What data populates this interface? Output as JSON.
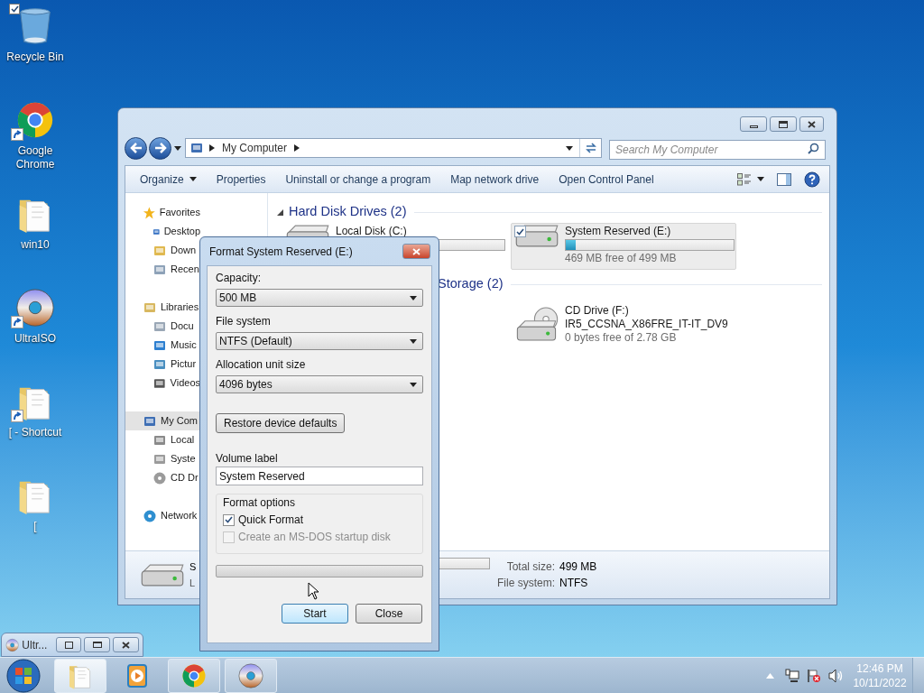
{
  "desktop_icons": [
    {
      "label": "Recycle Bin",
      "kind": "bin",
      "checked": true,
      "shortcut": false
    },
    {
      "label": "Google Chrome",
      "kind": "chrome",
      "checked": false,
      "shortcut": true
    },
    {
      "label": "win10",
      "kind": "folder",
      "checked": false,
      "shortcut": false
    },
    {
      "label": "UltraISO",
      "kind": "disc",
      "checked": false,
      "shortcut": true
    },
    {
      "label": "[ - Shortcut",
      "kind": "folder",
      "checked": false,
      "shortcut": true
    },
    {
      "label": "[",
      "kind": "folder",
      "checked": false,
      "shortcut": false
    }
  ],
  "explorer": {
    "address": "My Computer",
    "search_placeholder": "Search My Computer",
    "toolbar": [
      {
        "label": "Organize",
        "dropdown": true
      },
      {
        "label": "Properties",
        "dropdown": false
      },
      {
        "label": "Uninstall or change a program",
        "dropdown": false
      },
      {
        "label": "Map network drive",
        "dropdown": false
      },
      {
        "label": "Open Control Panel",
        "dropdown": false
      }
    ],
    "nav": [
      {
        "label": "Favorites",
        "kind": "star",
        "selected": false,
        "children": [
          {
            "label": "Desktop",
            "kind": "desktop",
            "selected": false
          },
          {
            "label": "Down",
            "kind": "download",
            "selected": false
          },
          {
            "label": "Recen",
            "kind": "recent",
            "selected": false
          }
        ]
      },
      {
        "label": "Libraries",
        "kind": "library",
        "selected": false,
        "children": [
          {
            "label": "Docu",
            "kind": "document",
            "selected": false
          },
          {
            "label": "Music",
            "kind": "music",
            "selected": false
          },
          {
            "label": "Pictur",
            "kind": "picture",
            "selected": false
          },
          {
            "label": "Videos",
            "kind": "video",
            "selected": false
          }
        ]
      },
      {
        "label": "My Com",
        "kind": "computer",
        "selected": true,
        "children": [
          {
            "label": "Local",
            "kind": "windows-drive",
            "selected": false
          },
          {
            "label": "Syste",
            "kind": "drive",
            "selected": false
          },
          {
            "label": "CD Dr",
            "kind": "cd",
            "selected": false
          }
        ]
      },
      {
        "label": "Network",
        "kind": "network",
        "selected": false
      }
    ],
    "groups": [
      {
        "title": "Hard Disk Drives (2)",
        "tiles": [
          {
            "name": "Local Disk (C:)",
            "kind": "hdd",
            "selected": false,
            "checked": false
          },
          {
            "name": "System Reserved (E:)",
            "kind": "hdd",
            "selected": true,
            "checked": true,
            "level": 0.06,
            "free": "469 MB free of 499 MB"
          }
        ]
      },
      {
        "title": "Storage (2)",
        "tiles": [
          {
            "name": "CD Drive (F:)",
            "kind": "cd",
            "selected": false,
            "checked": false,
            "subtitle": "IR5_CCSNA_X86FRE_IT-IT_DV9",
            "free": "0 bytes free of 2.78 GB"
          }
        ]
      }
    ],
    "details": {
      "title": "S",
      "subtitle": "L",
      "total_label": "Total size:",
      "total": "499 MB",
      "fs_label": "File system:",
      "fs": "NTFS"
    }
  },
  "dialog": {
    "title": "Format System Reserved (E:)",
    "fields": [
      {
        "kind": "select",
        "label": "Capacity:",
        "value": "500 MB"
      },
      {
        "kind": "select",
        "label": "File system",
        "value": "NTFS (Default)"
      },
      {
        "kind": "select",
        "label": "Allocation unit size",
        "value": "4096 bytes"
      },
      {
        "kind": "button",
        "label": "Restore device defaults"
      },
      {
        "kind": "input",
        "label": "Volume label",
        "value": "System Reserved"
      }
    ],
    "options_title": "Format options",
    "options": [
      {
        "label": "Quick Format",
        "checked": true,
        "disabled": false
      },
      {
        "label": "Create an MS-DOS startup disk",
        "checked": false,
        "disabled": true
      }
    ],
    "progress": {
      "level": 0
    },
    "buttons": [
      {
        "label": "Start",
        "default": true
      },
      {
        "label": "Close",
        "default": false
      }
    ]
  },
  "minimized_window": {
    "title": "Ultr..."
  },
  "taskbar": {
    "items": [
      {
        "kind": "explorer",
        "selected": true,
        "running": true
      },
      {
        "kind": "media",
        "selected": false,
        "running": false
      },
      {
        "kind": "chrome",
        "selected": false,
        "running": true
      },
      {
        "kind": "disc",
        "selected": false,
        "running": true
      }
    ],
    "time": "12:46 PM",
    "date": "10/11/2022"
  }
}
